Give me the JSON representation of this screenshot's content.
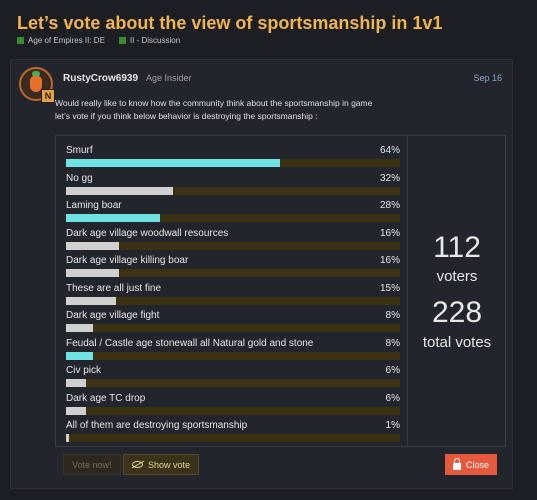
{
  "topic": {
    "title": "Let’s vote about the view of sportsmanship in 1v1",
    "categories": [
      {
        "name": "Age of Empires II: DE",
        "color": "#3a8a2e"
      },
      {
        "name": "II - Discussion",
        "color": "#3a8a2e"
      }
    ]
  },
  "post": {
    "username": "RustyCrow6939",
    "user_title": "Age Insider",
    "date": "Sep 16",
    "avatar_badge": "N",
    "line1": "Would really like to know how the community think about the sportsmanship in game",
    "line2": "let’s vote if you think below behavior is destroying the sportsmanship :"
  },
  "poll": {
    "options": [
      {
        "label": "Smurf",
        "percent": "64%",
        "value": 64,
        "highlight": true
      },
      {
        "label": "No gg",
        "percent": "32%",
        "value": 32,
        "highlight": false
      },
      {
        "label": "Laming boar",
        "percent": "28%",
        "value": 28,
        "highlight": true
      },
      {
        "label": "Dark age village woodwall resources",
        "percent": "16%",
        "value": 16,
        "highlight": false
      },
      {
        "label": "Dark age village killing boar",
        "percent": "16%",
        "value": 16,
        "highlight": false
      },
      {
        "label": "These are all just fine",
        "percent": "15%",
        "value": 15,
        "highlight": false
      },
      {
        "label": "Dark age village fight",
        "percent": "8%",
        "value": 8,
        "highlight": false
      },
      {
        "label": "Feudal / Castle age stonewall all Natural gold and stone",
        "percent": "8%",
        "value": 8,
        "highlight": true
      },
      {
        "label": "Civ pick",
        "percent": "6%",
        "value": 6,
        "highlight": false
      },
      {
        "label": "Dark age TC drop",
        "percent": "6%",
        "value": 6,
        "highlight": false
      },
      {
        "label": "All of them are destroying sportsmanship",
        "percent": "1%",
        "value": 1,
        "highlight": false
      }
    ],
    "voters": "112",
    "voters_label": "voters",
    "total_votes": "228",
    "total_votes_label": "total votes",
    "vote_now_label": "Vote now!",
    "show_vote_label": "Show vote",
    "close_label": "Close"
  },
  "colors": {
    "accent_title": "#f0b64c",
    "bar_highlight": "#6fe3e3",
    "bar_track": "#3d3113",
    "close_button": "#e55a3c"
  }
}
